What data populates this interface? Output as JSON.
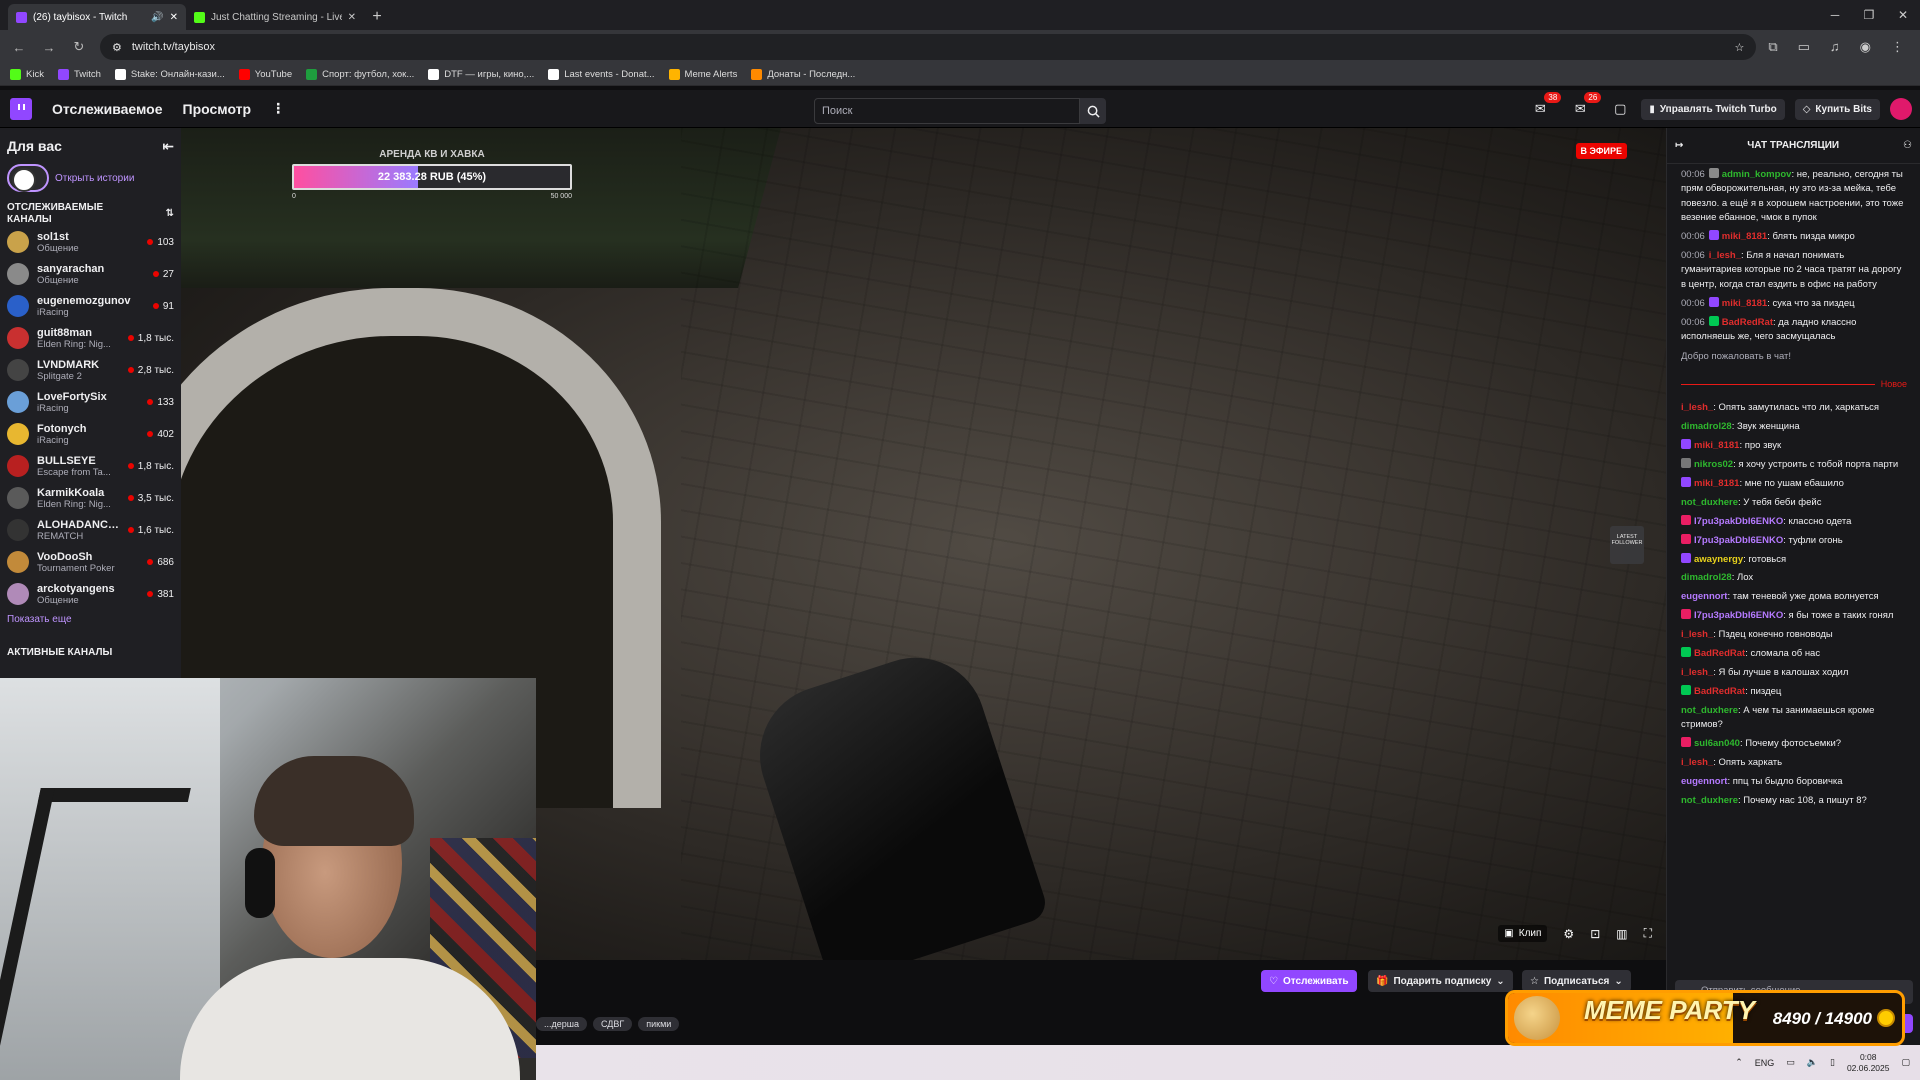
{
  "browser": {
    "tabs": [
      {
        "title": "(26) taybisox - Twitch",
        "active": true,
        "favicon_color": "#9147ff"
      },
      {
        "title": "Just Chatting Streaming - Live",
        "active": false,
        "favicon_color": "#53fc18"
      }
    ],
    "url": "twitch.tv/taybisox",
    "bookmarks": [
      {
        "label": "Kick",
        "color": "#53fc18"
      },
      {
        "label": "Twitch",
        "color": "#9147ff"
      },
      {
        "label": "Stake: Онлайн-кази...",
        "color": "#ffffff"
      },
      {
        "label": "YouTube",
        "color": "#ff0000"
      },
      {
        "label": "Спорт: футбол, хок...",
        "color": "#1e9e3e"
      },
      {
        "label": "DTF — игры, кино,...",
        "color": "#ffffff"
      },
      {
        "label": "Last events - Donat...",
        "color": "#ffffff"
      },
      {
        "label": "Meme Alerts",
        "color": "#ffb400"
      },
      {
        "label": "Донаты - Последн...",
        "color": "#ff8a00"
      }
    ]
  },
  "twitch_nav": {
    "following": "Отслеживаемое",
    "browse": "Просмотр",
    "more": "⋮",
    "search_placeholder": "Поиск",
    "inbox_badge": "38",
    "notif_badge": "26",
    "turbo": "Управлять Twitch Turbo",
    "bits": "Купить Bits",
    "accent": "#9147ff"
  },
  "sidebar": {
    "title": "Для вас",
    "stories": "Открыть истории",
    "followed_header": "ОТСЛЕЖИВАЕМЫЕ КАНАЛЫ",
    "channels": [
      {
        "name": "sol1st",
        "game": "Общение",
        "viewers": "103",
        "color": "#c9a24a"
      },
      {
        "name": "sanyarachan",
        "game": "Общение",
        "viewers": "27",
        "color": "#8a8a8a"
      },
      {
        "name": "eugenemozgunov",
        "game": "iRacing",
        "viewers": "91",
        "color": "#2a60c9"
      },
      {
        "name": "guit88man",
        "game": "Elden Ring: Nig...",
        "viewers": "1,8 тыс.",
        "color": "#c93030"
      },
      {
        "name": "LVNDMARK",
        "game": "Splitgate 2",
        "viewers": "2,8 тыс.",
        "color": "#444444"
      },
      {
        "name": "LoveFortySix",
        "game": "iRacing",
        "viewers": "133",
        "color": "#6a9fd8"
      },
      {
        "name": "Fotonych",
        "game": "iRacing",
        "viewers": "402",
        "color": "#e8b730"
      },
      {
        "name": "BULLSEYE",
        "game": "Escape from Ta...",
        "viewers": "1,8 тыс.",
        "color": "#b82020"
      },
      {
        "name": "KarmikKoala",
        "game": "Elden Ring: Nig...",
        "viewers": "3,5 тыс.",
        "color": "#5a5a5a"
      },
      {
        "name": "ALOHADANCE...",
        "game": "REMATCH",
        "viewers": "1,6 тыс.",
        "color": "#333333"
      },
      {
        "name": "VooDooSh",
        "game": "Tournament Poker",
        "viewers": "686",
        "color": "#c28a3a"
      },
      {
        "name": "arckotyangens",
        "game": "Общение",
        "viewers": "381",
        "color": "#b08ab8"
      }
    ],
    "show_more": "Показать еще",
    "active_header": "АКТИВНЫЕ КАНАЛЫ"
  },
  "player": {
    "goal_title": "АРЕНДА КВ И ХАВКА",
    "goal_text": "22 383.28 RUB (45%)",
    "goal_fraction": 0.45,
    "goal_min": "0",
    "goal_max": "50 000",
    "live": "В ЭФИРЕ",
    "follow_widget": "LATEST FOLLOWER",
    "clip": "Клип"
  },
  "channel_bar": {
    "follow": "Отслеживать",
    "gift": "Подарить подписку",
    "subscribe": "Подписаться",
    "tags": [
      "...дерша",
      "СДВГ",
      "пикми"
    ]
  },
  "chat": {
    "header": "ЧАТ ТРАНСЛЯЦИИ",
    "old_messages": [
      {
        "time": "00:06",
        "user": "admin_kompov",
        "color": "#2eb82e",
        "badge": "#8a8a8a",
        "text": "не, реально, сегодня ты прям обворожительная, ну это из-за мейка, тебе повезло. а ещё я в хорошем настроении, это тоже везение ебанное, чмок в пупок"
      },
      {
        "time": "00:06",
        "user": "miki_8181",
        "color": "#e02d2d",
        "badge": "#9147ff",
        "text": "блять пизда микро"
      },
      {
        "time": "00:06",
        "user": "i_lesh_",
        "color": "#e02d2d",
        "badge": "",
        "text": "Бля я начал понимать гуманитариев которые по 2 часа тратят на дорогу в центр, когда стал ездить в офис на работу"
      },
      {
        "time": "00:06",
        "user": "miki_8181",
        "color": "#e02d2d",
        "badge": "#9147ff",
        "text": "сука что за пиздец"
      },
      {
        "time": "00:06",
        "user": "BadRedRat",
        "color": "#e02d2d",
        "badge": "#00c853",
        "text": "да ладно классно исполняешь же, чего засмущалась"
      }
    ],
    "welcome": "Добро пожаловать в чат!",
    "new_label": "Новое",
    "new_messages": [
      {
        "user": "i_lesh_",
        "color": "#e02d2d",
        "badge": "",
        "text": "Опять замутилась что ли, харкаться"
      },
      {
        "user": "dimadrol28",
        "color": "#2eb82e",
        "badge": "",
        "text": "Звук женщина"
      },
      {
        "user": "miki_8181",
        "color": "#e02d2d",
        "badge": "#9147ff",
        "text": "про звук"
      },
      {
        "user": "nikros02",
        "color": "#2eb82e",
        "badge": "#777777",
        "text": "я хочу устроить с тобой порта парти"
      },
      {
        "user": "miki_8181",
        "color": "#e02d2d",
        "badge": "#9147ff",
        "text": "мне по ушам ебашило"
      },
      {
        "user": "not_duxhere",
        "color": "#2eb82e",
        "badge": "",
        "text": "У тебя беби фейс"
      },
      {
        "user": "I7pu3pakDbI6ENKO",
        "color": "#b57aff",
        "badge": "#e91e63",
        "text": "классно одета"
      },
      {
        "user": "I7pu3pakDbI6ENKO",
        "color": "#b57aff",
        "badge": "#e91e63",
        "text": "туфли огонь"
      },
      {
        "user": "awaynergy",
        "color": "#e8d21d",
        "badge": "#9147ff",
        "text": "готовься"
      },
      {
        "user": "dimadrol28",
        "color": "#2eb82e",
        "badge": "",
        "text": "Лох"
      },
      {
        "user": "eugennort",
        "color": "#b57aff",
        "badge": "",
        "text": "там теневой уже дома волнуется"
      },
      {
        "user": "I7pu3pakDbI6ENKO",
        "color": "#b57aff",
        "badge": "#e91e63",
        "text": "я бы тоже в таких гонял"
      },
      {
        "user": "i_lesh_",
        "color": "#e02d2d",
        "badge": "",
        "text": "Пздец конечно говноводы"
      },
      {
        "user": "BadRedRat",
        "color": "#e02d2d",
        "badge": "#00c853",
        "text": "сломала об нас"
      },
      {
        "user": "i_lesh_",
        "color": "#e02d2d",
        "badge": "",
        "text": "Я бы лучше в калошах ходил"
      },
      {
        "user": "BadRedRat",
        "color": "#e02d2d",
        "badge": "#00c853",
        "text": "пиздец"
      },
      {
        "user": "not_duxhere",
        "color": "#2eb82e",
        "badge": "",
        "text": "А чем ты занимаешься кроме стримов?"
      },
      {
        "user": "sul6an040",
        "color": "#2eb82e",
        "badge": "#e91e63",
        "text": "Почему фотосъемки?"
      },
      {
        "user": "i_lesh_",
        "color": "#e02d2d",
        "badge": "",
        "text": "Опять харкать"
      },
      {
        "user": "eugennort",
        "color": "#b57aff",
        "badge": "",
        "text": "ппц ты быдло боровичка"
      },
      {
        "user": "not_duxhere",
        "color": "#2eb82e",
        "badge": "",
        "text": "Почему нас 108, а пишут 8?"
      }
    ],
    "input_placeholder": "Отправить сообщение",
    "send": "Чат"
  },
  "meme_party": {
    "title": "MEME PARTY",
    "count": "8490 / 14900",
    "fraction": 0.57
  },
  "taskbar": {
    "lang": "ENG",
    "time": "0:08",
    "date": "02.06.2025"
  }
}
